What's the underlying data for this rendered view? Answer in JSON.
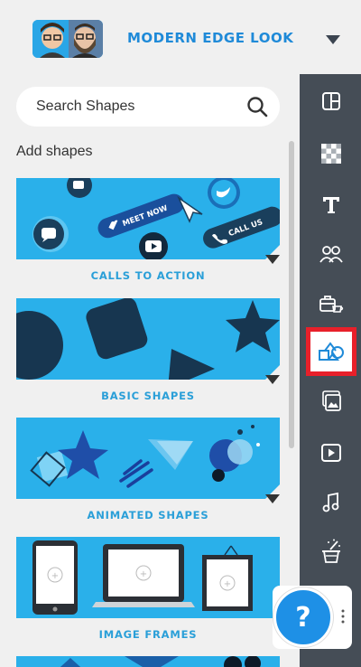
{
  "header": {
    "title": "MODERN EDGE LOOK",
    "avatar_icon": "two-person-avatar",
    "caret_icon": "caret-down-icon"
  },
  "search": {
    "placeholder": "Search Shapes",
    "icon": "search-icon"
  },
  "section": {
    "title": "Add shapes"
  },
  "cards": [
    {
      "label": "CALLS TO ACTION",
      "texts": {
        "meet_now": "MEET NOW",
        "call_us": "CALL US"
      }
    },
    {
      "label": "BASIC SHAPES"
    },
    {
      "label": "ANIMATED SHAPES"
    },
    {
      "label": "IMAGE FRAMES"
    }
  ],
  "rail": {
    "items": [
      {
        "name": "layout",
        "icon": "layout-grid-icon"
      },
      {
        "name": "background",
        "icon": "checkerboard-icon"
      },
      {
        "name": "text",
        "icon": "text-icon"
      },
      {
        "name": "people",
        "icon": "people-group-icon"
      },
      {
        "name": "business",
        "icon": "briefcase-coffee-icon"
      },
      {
        "name": "shapes",
        "icon": "shapes-icon",
        "active": true
      },
      {
        "name": "photos",
        "icon": "photo-stack-icon"
      },
      {
        "name": "video",
        "icon": "video-play-icon"
      },
      {
        "name": "music",
        "icon": "music-note-icon"
      },
      {
        "name": "magic",
        "icon": "magic-hat-icon"
      }
    ]
  },
  "help": {
    "label": "?",
    "icon": "help-question-icon"
  },
  "colors": {
    "accent": "#1f8ad8",
    "card_bg": "#2ab0ea",
    "rail_bg": "#454d56",
    "active_border": "#e8202a",
    "panel_bg": "#f0f0f0"
  }
}
